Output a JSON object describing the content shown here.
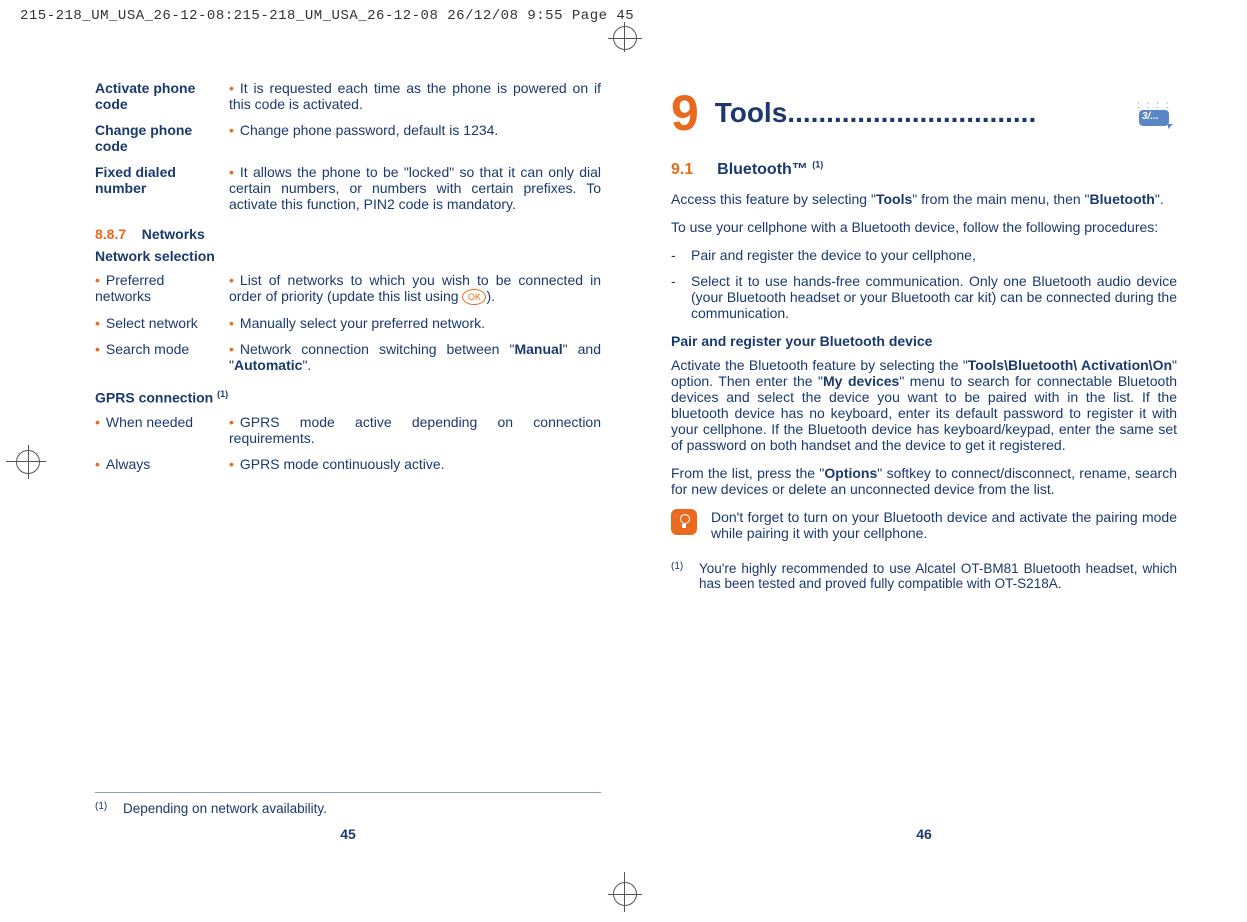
{
  "print_header": "215-218_UM_USA_26-12-08:215-218_UM_USA_26-12-08  26/12/08  9:55  Page 45",
  "left": {
    "defs": [
      {
        "term": "Activate phone code",
        "bullet": "•",
        "desc": "It is requested each time as the phone is powered on if this code is activated."
      },
      {
        "term": "Change phone code",
        "bullet": "•",
        "desc": "Change phone password, default is 1234."
      },
      {
        "term": "Fixed dialed number",
        "bullet": "•",
        "desc": "It allows the phone to be \"locked\" so that it can only dial certain numbers, or numbers with certain prefixes. To activate this function, PIN2 code is mandatory."
      }
    ],
    "sec_num": "8.8.7",
    "sec_title": "Networks",
    "net_sel_title": "Network selection",
    "net_rows": [
      {
        "term": "Preferred networks",
        "desc_a": "List of networks to which you wish to be connected in order of priority (update this list using ",
        "ok": "OK",
        "desc_b": ")."
      },
      {
        "term": "Select network",
        "desc": "Manually select your preferred network."
      },
      {
        "term": "Search mode",
        "desc_a": "Network connection switching between \"",
        "b1": "Manual",
        "mid": "\" and \"",
        "b2": "Automatic",
        "desc_b": "\"."
      }
    ],
    "gprs_title": "GPRS connection ",
    "gprs_sup": "(1)",
    "gprs_rows": [
      {
        "term": "When needed",
        "desc": "GPRS mode active depending on connection requirements."
      },
      {
        "term": "Always",
        "desc": "GPRS mode continuously active."
      }
    ],
    "footnote_mark": "(1)",
    "footnote_text": "Depending on network availability.",
    "page_num": "45"
  },
  "right": {
    "chap_num": "9",
    "chap_title": "Tools................................",
    "icon_label": "3/...",
    "sec_num": "9.1",
    "sec_title": "Bluetooth™ ",
    "sec_sup": "(1)",
    "p1_a": "Access this feature by selecting \"",
    "p1_b": "Tools",
    "p1_c": "\" from the main menu, then \"",
    "p1_d": "Bluetooth",
    "p1_e": "\".",
    "p2": "To use your cellphone with a Bluetooth device, follow the following procedures:",
    "bul1": "Pair and register the device to your cellphone,",
    "bul2": "Select it to use hands-free communication. Only one Bluetooth audio device (your Bluetooth headset or your Bluetooth car kit) can be connected during the communication.",
    "pair_title": "Pair and register your Bluetooth device",
    "p3_a": "Activate the Bluetooth feature by selecting the \"",
    "p3_b": "Tools\\Bluetooth\\ Activation\\On",
    "p3_c": "\" option. Then enter the \"",
    "p3_d": "My devices",
    "p3_e": "\" menu to search for connectable Bluetooth devices and select the device you want to be paired with in the list. If the bluetooth device has no keyboard, enter its default password to register it with your cellphone. If the Bluetooth device has keyboard/keypad, enter the same set of password on both handset and the device to get it registered.",
    "p4_a": "From the list, press the \"",
    "p4_b": "Options",
    "p4_c": "\" softkey to connect/disconnect, rename, search for new devices or delete an unconnected device from the list.",
    "tip": "Don't forget to turn on your Bluetooth device and activate the pairing mode while pairing it with your cellphone.",
    "fn_mark": "(1)",
    "fn_text": "You're highly recommended to use Alcatel OT-BM81 Bluetooth headset, which has been tested and proved fully compatible with OT-S218A.",
    "page_num": "46"
  }
}
